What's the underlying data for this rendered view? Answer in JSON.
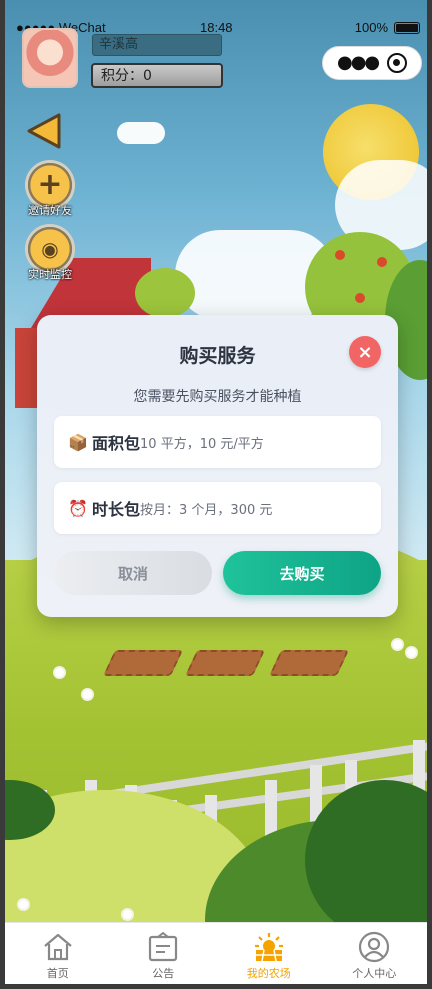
{
  "status_bar": {
    "carrier": "●●●●● WeChat",
    "time": "18:48",
    "battery": "100%"
  },
  "user": {
    "name": "辛溪高",
    "score_label": "积分：0"
  },
  "side_buttons": {
    "invite_label": "邀请好友",
    "monitor_label": "实时监控"
  },
  "modal": {
    "title": "购买服务",
    "close_symbol": "×",
    "subtitle": "您需要先购买服务才能种植",
    "packages": [
      {
        "icon": "box-icon",
        "icon_glyph": "📦",
        "name": "面积包",
        "desc": "10 平方，10 元/平方"
      },
      {
        "icon": "alarm-clock-icon",
        "icon_glyph": "⏰",
        "name": "时长包",
        "desc": "按月：3 个月，300 元"
      }
    ],
    "cancel_label": "取消",
    "buy_label": "去购买"
  },
  "tabbar": {
    "tabs": [
      {
        "label": "首页",
        "icon": "home-icon",
        "active": false
      },
      {
        "label": "公告",
        "icon": "notice-icon",
        "active": false
      },
      {
        "label": "我的农场",
        "icon": "farm-sun-icon",
        "active": true
      },
      {
        "label": "个人中心",
        "icon": "user-icon",
        "active": false
      }
    ]
  },
  "colors": {
    "accent_green": "#0ea386",
    "close_red": "#f26565",
    "tab_active": "#f0a400"
  }
}
